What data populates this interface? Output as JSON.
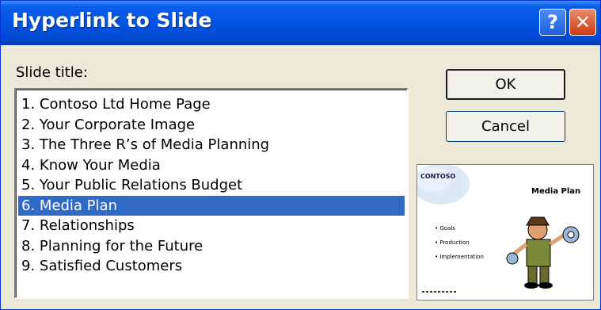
{
  "window": {
    "title": "Hyperlink to Slide",
    "help_glyph": "?",
    "close_glyph": "✕"
  },
  "list": {
    "label": "Slide title:",
    "items": [
      "1. Contoso Ltd Home Page",
      "2. Your Corporate Image",
      "3. The Three R’s of Media Planning",
      "4. Know Your Media",
      "5. Your Public Relations Budget",
      "6. Media Plan",
      "7. Relationships",
      "8. Planning for the Future",
      "9. Satisfied Customers"
    ],
    "selected_index": 5
  },
  "buttons": {
    "ok": "OK",
    "cancel": "Cancel"
  },
  "preview": {
    "logo_text": "CONTOSO",
    "slide_title": "Media Plan",
    "bullets": [
      "• Goals",
      "• Production",
      "• Implementation"
    ]
  },
  "colors": {
    "titlebar": "#0054e3",
    "selection": "#316ac5",
    "dialog_bg": "#ece9d8"
  }
}
